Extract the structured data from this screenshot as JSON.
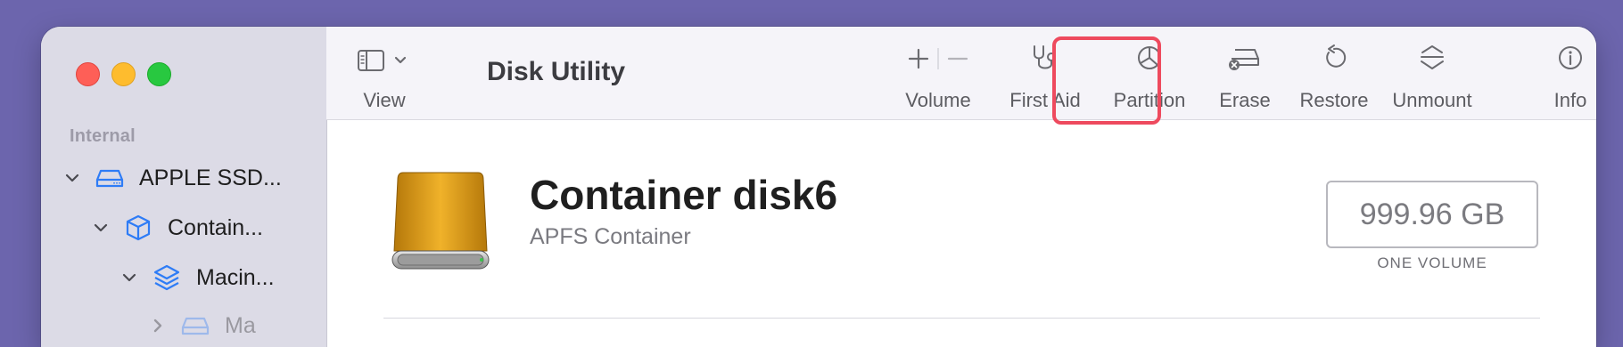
{
  "window": {
    "title": "Disk Utility"
  },
  "toolbar": {
    "view_label": "View",
    "volume_label": "Volume",
    "first_aid_label": "First Aid",
    "partition_label": "Partition",
    "erase_label": "Erase",
    "restore_label": "Restore",
    "unmount_label": "Unmount",
    "info_label": "Info"
  },
  "sidebar": {
    "section": "Internal",
    "items": [
      {
        "label": "APPLE SSD...",
        "icon": "internal-drive-icon"
      },
      {
        "label": "Contain...",
        "icon": "container-cube-icon"
      },
      {
        "label": "Macin...",
        "icon": "volume-stack-icon"
      },
      {
        "label": "Ma",
        "icon": "internal-drive-icon"
      }
    ]
  },
  "detail": {
    "name": "Container disk6",
    "type": "APFS Container",
    "capacity": "999.96 GB",
    "capacity_caption": "ONE VOLUME"
  },
  "colors": {
    "accent_highlight": "#ee4a5e",
    "sidebar_icon": "#2e7cf6",
    "disk_gold": "#e8a31a",
    "background": "#6c65ad"
  }
}
